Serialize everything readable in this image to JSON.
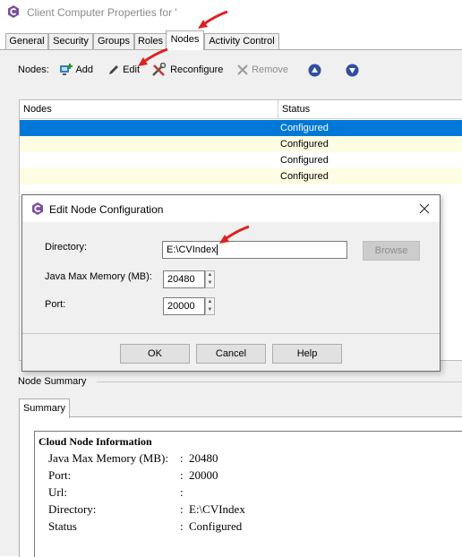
{
  "window": {
    "title": "Client Computer Properties for '",
    "icon": "commvault-app-icon"
  },
  "tabs": [
    "General",
    "Security",
    "Groups",
    "Roles",
    "Nodes",
    "Activity Control"
  ],
  "active_tab": "Nodes",
  "toolbar": {
    "label": "Nodes:",
    "add": "Add",
    "edit": "Edit",
    "reconfigure": "Reconfigure",
    "remove": "Remove"
  },
  "table": {
    "columns": [
      "Nodes",
      "Status"
    ],
    "rows": [
      {
        "node": "",
        "status": "Configured"
      },
      {
        "node": "",
        "status": "Configured"
      },
      {
        "node": "",
        "status": "Configured"
      },
      {
        "node": "",
        "status": "Configured"
      }
    ]
  },
  "dialog": {
    "title": "Edit Node Configuration",
    "directory_label": "Directory:",
    "directory_value": "E:\\CVIndex",
    "browse": "Browse",
    "java_label": "Java Max Memory (MB):",
    "java_value": "20480",
    "port_label": "Port:",
    "port_value": "20000",
    "ok": "OK",
    "cancel": "Cancel",
    "help": "Help"
  },
  "summary": {
    "section_label": "Node Summary",
    "tab": "Summary",
    "heading": "Cloud Node Information",
    "items": [
      {
        "label": "Java Max Memory (MB):",
        "sep": ":",
        "value": "20480"
      },
      {
        "label": "Port:",
        "sep": ":",
        "value": "20000"
      },
      {
        "label": "Url:",
        "sep": ":",
        "value": ""
      },
      {
        "label": "Directory:",
        "sep": ":",
        "value": "E:\\CVIndex"
      },
      {
        "label": "Status",
        "sep": ":",
        "value": "Configured"
      }
    ]
  },
  "colors": {
    "selection": "#0078d7",
    "annotation_arrow": "#e02020",
    "alt_row": "#fdfde4"
  }
}
